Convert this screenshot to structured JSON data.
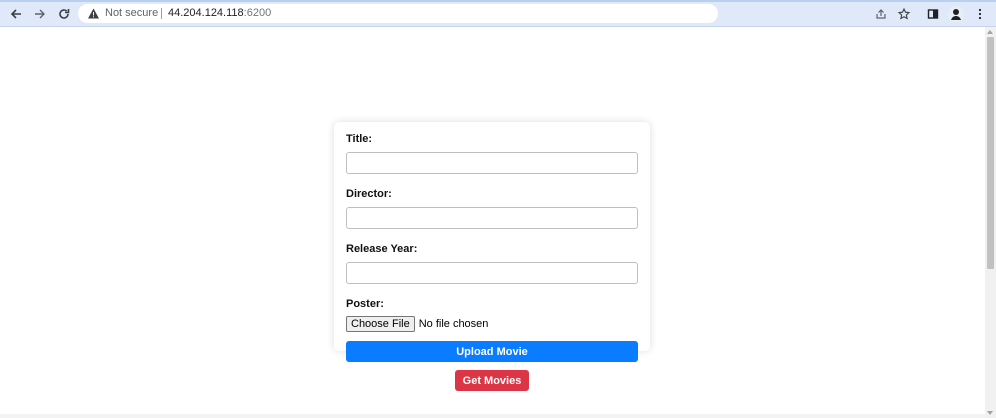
{
  "browser": {
    "security_label": "Not secure",
    "url_host": "44.204.124.118",
    "url_port": ":6200",
    "icons": {
      "back": "arrow-left-icon",
      "forward": "arrow-right-icon",
      "reload": "reload-icon",
      "security": "warning-icon",
      "share": "share-icon",
      "bookmark": "star-icon",
      "side_panel": "side-panel-icon",
      "profile": "profile-avatar-icon",
      "menu": "kebab-menu-icon"
    }
  },
  "form": {
    "title_label": "Title:",
    "director_label": "Director:",
    "release_year_label": "Release Year:",
    "poster_label": "Poster:",
    "title_value": "",
    "director_value": "",
    "release_year_value": "",
    "file_button": "Choose File",
    "file_status": "No file chosen",
    "upload_button": "Upload Movie"
  },
  "get_movies_button": "Get Movies",
  "colors": {
    "upload_button": "#0a7cff",
    "get_movies_button": "#dc3545",
    "chrome_bar": "#dfe9f9"
  }
}
